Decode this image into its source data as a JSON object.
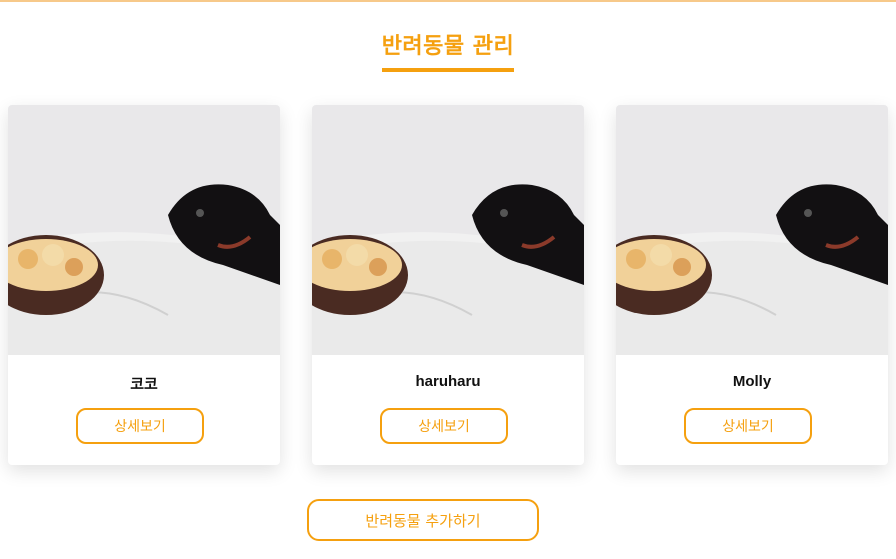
{
  "page": {
    "title": "반려동물 관리"
  },
  "pets": [
    {
      "name": "코코",
      "detail_label": "상세보기"
    },
    {
      "name": "haruharu",
      "detail_label": "상세보기"
    },
    {
      "name": "Molly",
      "detail_label": "상세보기"
    }
  ],
  "actions": {
    "add_pet_label": "반려동물 추가하기"
  },
  "colors": {
    "accent": "#f5a00f",
    "background": "#ffffff"
  }
}
